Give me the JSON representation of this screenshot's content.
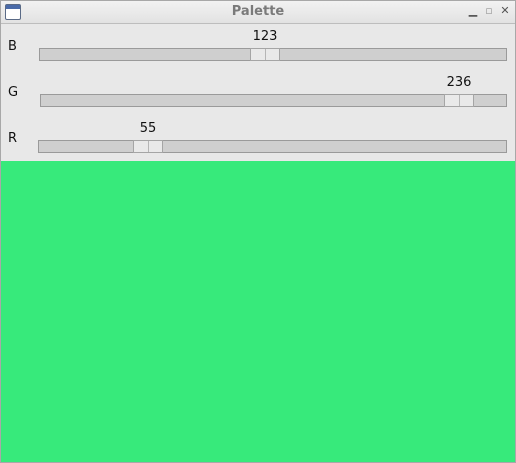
{
  "window": {
    "title": "Palette",
    "minimize_icon": "minimize-icon",
    "maximize_icon": "maximize-icon",
    "close_icon": "close-icon"
  },
  "sliders": [
    {
      "label": "B",
      "value": 123,
      "value_text": "123",
      "max": 255
    },
    {
      "label": "G",
      "value": 236,
      "value_text": "236",
      "max": 255
    },
    {
      "label": "R",
      "value": 55,
      "value_text": "55",
      "max": 255
    }
  ],
  "preview": {
    "color": "#37EA7B"
  }
}
